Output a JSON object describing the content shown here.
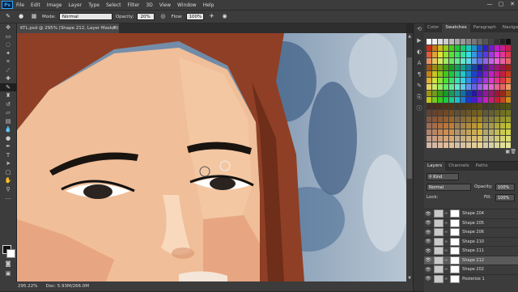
{
  "app": {
    "logo": "Ps"
  },
  "menu": [
    "File",
    "Edit",
    "Image",
    "Layer",
    "Type",
    "Select",
    "Filter",
    "3D",
    "View",
    "Window",
    "Help"
  ],
  "window_controls": [
    "—",
    "▢",
    "✕"
  ],
  "options": {
    "mode_label": "Mode:",
    "mode_value": "Normal",
    "opacity_label": "Opacity:",
    "opacity_value": "20%",
    "flow_label": "Flow:",
    "flow_value": "100%"
  },
  "document": {
    "tab_title": "KTL.psd @ 295% (Shape 212, Layer Mask/8) *",
    "close": "×"
  },
  "status": {
    "zoom": "295.22%",
    "doc": "Doc: 5.93M/266.0M"
  },
  "panels": {
    "top_tabs": [
      "Color",
      "Swatches",
      "Paragraph",
      "Navigator"
    ],
    "active_top_tab": "Swatches",
    "layers_tabs": [
      "Layers",
      "Channels",
      "Paths"
    ],
    "active_layers_tab": "Layers",
    "kind_label": "Kind",
    "blend_mode": "Normal",
    "opacity_label": "Opacity:",
    "opacity_value": "100%",
    "lock_label": "Lock:",
    "fill_label": "Fill:",
    "fill_value": "100%",
    "layers": [
      {
        "name": "Shape 204",
        "selected": false
      },
      {
        "name": "Shape 205",
        "selected": false
      },
      {
        "name": "Shape 206",
        "selected": false
      },
      {
        "name": "Shape 210",
        "selected": false
      },
      {
        "name": "Shape 211",
        "selected": false
      },
      {
        "name": "Shape 212",
        "selected": true
      },
      {
        "name": "Shape 202",
        "selected": false
      },
      {
        "name": "Posterize 1",
        "selected": false
      }
    ]
  },
  "colors": {
    "accent": "#31a8ff",
    "panel": "#3c3c3c",
    "selected_layer": "#5a5a5a"
  }
}
